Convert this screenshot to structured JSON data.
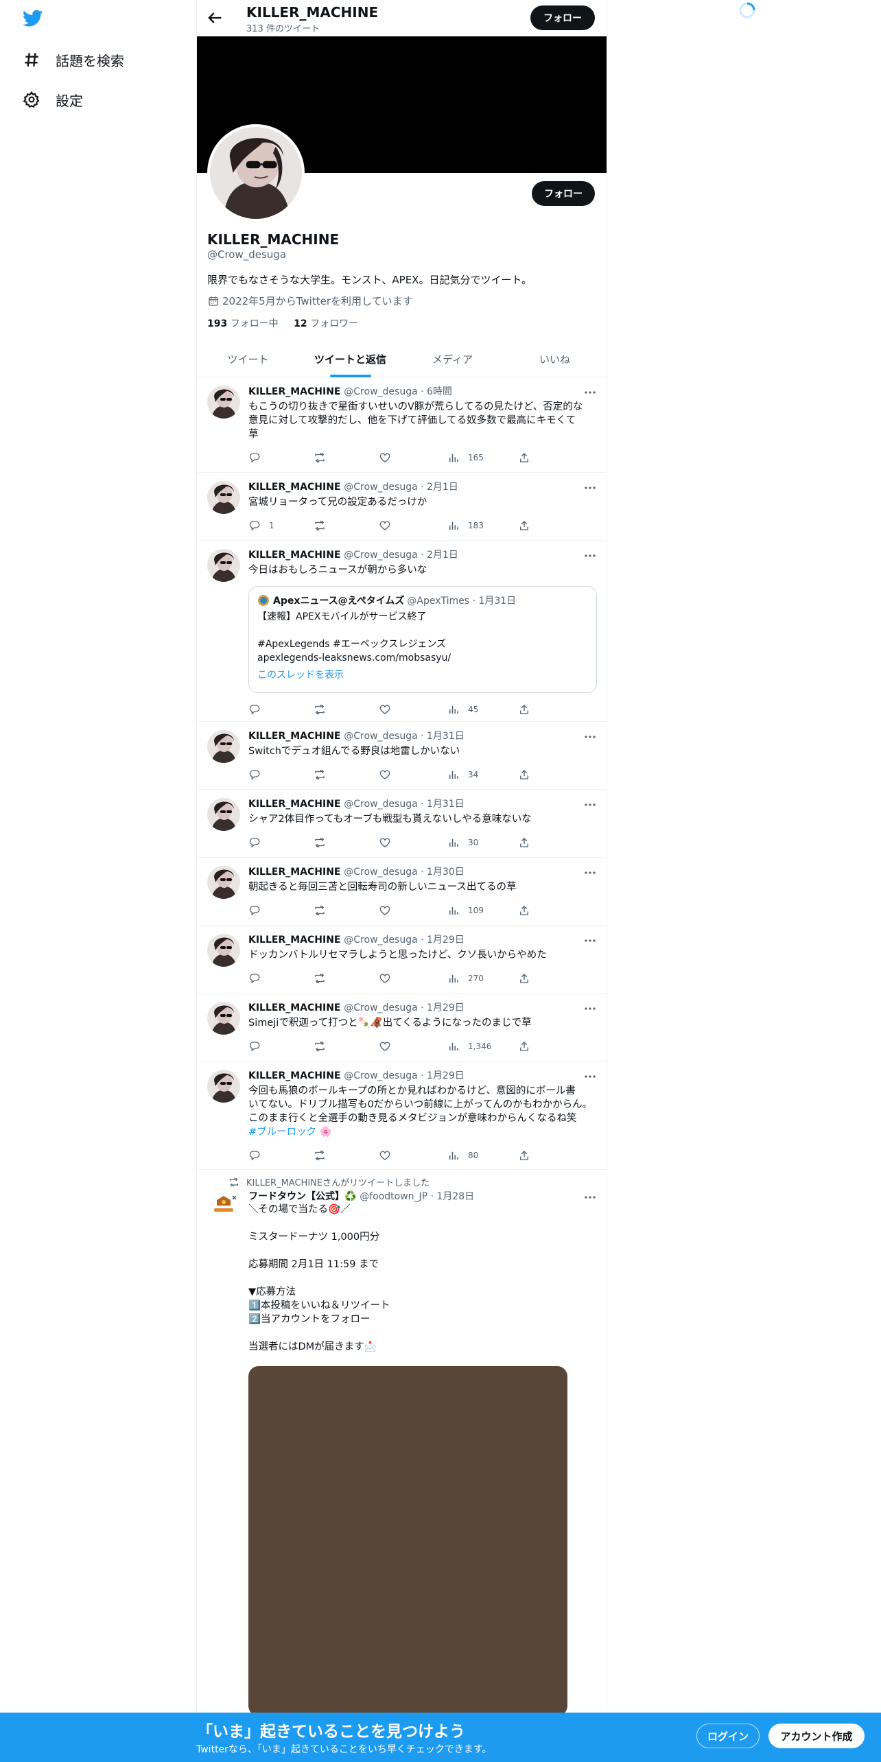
{
  "sidebar": {
    "explore_label": "話題を検索",
    "settings_label": "設定"
  },
  "header": {
    "title": "KILLER_MACHINE",
    "subtitle": "313 件のツイート",
    "follow_label": "フォロー"
  },
  "profile": {
    "name": "KILLER_MACHINE",
    "handle": "@Crow_desuga",
    "bio": "限界でもなさそうな大学生。モンスト、APEX。日記気分でツイート。",
    "joined": "2022年5月からTwitterを利用しています",
    "following_count": "193",
    "following_label": "フォロー中",
    "followers_count": "12",
    "followers_label": "フォロワー",
    "follow_label": "フォロー"
  },
  "tabs": [
    {
      "label": "ツイート"
    },
    {
      "label": "ツイートと返信"
    },
    {
      "label": "メディア"
    },
    {
      "label": "いいね"
    }
  ],
  "tweets": [
    {
      "name": "KILLER_MACHINE",
      "meta": "@Crow_desuga · 6時間",
      "text": "もこうの切り抜きで星街すいせいのV豚が荒らしてるの見たけど、否定的な\n意見に対して攻撃的だし、他を下げて評価してる奴多数で最高にキモくて\n草",
      "replies": "",
      "views": "165"
    },
    {
      "name": "KILLER_MACHINE",
      "meta": "@Crow_desuga · 2月1日",
      "text": "宮城リョータって兄の設定あるだっけか",
      "replies": "1",
      "views": "183"
    },
    {
      "name": "KILLER_MACHINE",
      "meta": "@Crow_desuga · 2月1日",
      "text": "今日はおもしろニュースが朝から多いな",
      "replies": "",
      "views": "45",
      "quote": {
        "name": "Apexニュース@えぺタイムズ",
        "meta": "@ApexTimes · 1月31日",
        "text": "【速報】APEXモバイルがサービス終了\n\n#ApexLegends #エーペックスレジェンズ\napexlegends-leaksnews.com/mobsasyu/",
        "thread": "このスレッドを表示"
      }
    },
    {
      "name": "KILLER_MACHINE",
      "meta": "@Crow_desuga · 1月31日",
      "text": "Switchでデュオ組んでる野良は地雷しかいない",
      "replies": "",
      "views": "34"
    },
    {
      "name": "KILLER_MACHINE",
      "meta": "@Crow_desuga · 1月31日",
      "text": "シャア2体目作ってもオーブも戦型も貰えないしやる意味ないな",
      "replies": "",
      "views": "30"
    },
    {
      "name": "KILLER_MACHINE",
      "meta": "@Crow_desuga · 1月30日",
      "text": "朝起きると毎回三苫と回転寿司の新しいニュース出てるの草",
      "replies": "",
      "views": "109"
    },
    {
      "name": "KILLER_MACHINE",
      "meta": "@Crow_desuga · 1月29日",
      "text": "ドッカンバトルリセマラしようと思ったけど、クソ長いからやめた",
      "replies": "",
      "views": "270"
    },
    {
      "name": "KILLER_MACHINE",
      "meta": "@Crow_desuga · 1月29日",
      "text": "Simejiで釈迦って打つと🍡🦧出てくるようになったのまじで草",
      "replies": "",
      "views": "1,346"
    },
    {
      "name": "KILLER_MACHINE",
      "meta": "@Crow_desuga · 1月29日",
      "text": "今回も馬狼のボールキープの所とか見ればわかるけど、意図的にボール書\nいてない。ドリブル描写も0だからいつ前線に上がってんのかもわかからん。\nこのまま行くと全選手の動き見るメタビジョンが意味わからんくなるね笑",
      "hashtag": "#ブルーロック 🌸",
      "replies": "",
      "views": "80"
    }
  ],
  "retweet": {
    "rt_label": "KILLER_MACHINEさんがリツイートしました",
    "name": "フードタウン【公式】♻️",
    "meta": "@foodtown_JP · 1月28日",
    "text": "＼その場で当たる🎯／\n\nミスタードーナツ 1,000円分\n\n応募期間 2月1日 11:59 まで\n\n▼応募方法\n1️⃣本投稿をいいね＆リツイート\n2️⃣当アカウントをフォロー\n\n当選者にはDMが届きます📩"
  },
  "bottom_bar": {
    "title": "「いま」起きていることを見つけよう",
    "subtitle": "Twitterなら、「いま」起きていることをいち早くチェックできます。",
    "login_label": "ログイン",
    "signup_label": "アカウント作成"
  },
  "colors": {
    "accent": "#1d9bf0",
    "dark": "#0f1419",
    "muted": "#536471",
    "media": "#584639"
  }
}
